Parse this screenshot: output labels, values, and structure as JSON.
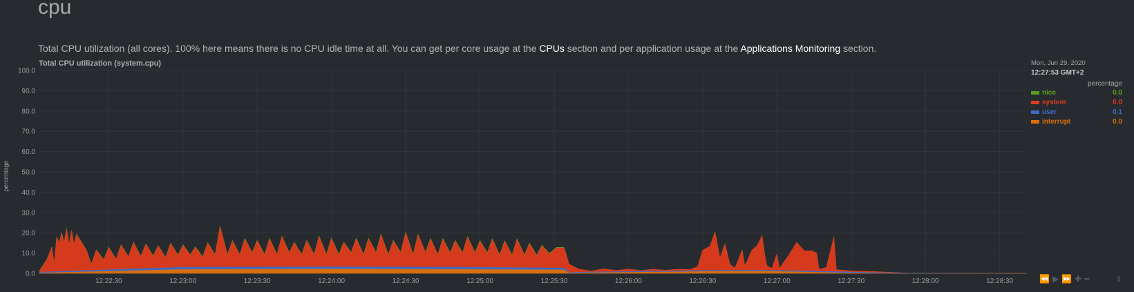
{
  "section": {
    "title": "cpu",
    "description": {
      "part1": "Total CPU utilization (all cores). 100% here means there is no CPU idle time at all. You can get per core usage at the ",
      "link1": "CPUs",
      "part2": " section and per application usage at the ",
      "link2": "Applications Monitoring",
      "part3": " section."
    }
  },
  "legend": {
    "date": "Mon, Jun 29, 2020",
    "time": "12:27:53 GMT+2",
    "units": "percentage",
    "items": [
      {
        "name": "nice",
        "value": "0.0",
        "color": "#5a9e1c"
      },
      {
        "name": "system",
        "value": "0.0",
        "color": "#de3b1c"
      },
      {
        "name": "user",
        "value": "0.1",
        "color": "#3d6cc7"
      },
      {
        "name": "interrupt",
        "value": "0.0",
        "color": "#d86e0c"
      }
    ]
  },
  "toolbar": {
    "icons": [
      "rewind-icon",
      "play-icon",
      "fast-forward-icon",
      "zoom-in-icon",
      "zoom-out-icon"
    ],
    "glyphs": [
      "⏪",
      "▶",
      "⏩",
      "✚",
      "━"
    ],
    "resize_glyph": "⬍"
  },
  "chart_data": {
    "type": "area",
    "stacked": true,
    "title": "Total CPU utilization (system.cpu)",
    "ylabel": "percentage",
    "ylim": [
      0,
      100
    ],
    "yticks": [
      "0.0",
      "10.0",
      "20.0",
      "30.0",
      "40.0",
      "50.0",
      "60.0",
      "70.0",
      "80.0",
      "90.0",
      "100.0"
    ],
    "xlim": [
      "12:22:02",
      "12:28:41"
    ],
    "xticks": [
      "12:22:30",
      "12:23:00",
      "12:23:30",
      "12:24:00",
      "12:24:30",
      "12:25:00",
      "12:25:30",
      "12:26:00",
      "12:26:30",
      "12:27:00",
      "12:27:30",
      "12:28:00",
      "12:28:30"
    ],
    "grid": true,
    "legend_position": "right",
    "series": [
      {
        "name": "interrupt",
        "color": "#d86e0c",
        "points": [
          [
            "12:22:02",
            0.3
          ],
          [
            "12:23:00",
            2.0
          ],
          [
            "12:24:00",
            2.2
          ],
          [
            "12:25:00",
            2.0
          ],
          [
            "12:25:34",
            1.8
          ],
          [
            "12:25:36",
            0.3
          ],
          [
            "12:26:30",
            1.0
          ],
          [
            "12:26:55",
            1.2
          ],
          [
            "12:27:25",
            0.4
          ],
          [
            "12:27:53",
            0.0
          ],
          [
            "12:28:41",
            0.0
          ]
        ]
      },
      {
        "name": "user",
        "color": "#3d6cc7",
        "points": [
          [
            "12:22:02",
            0.3
          ],
          [
            "12:23:00",
            1.0
          ],
          [
            "12:24:00",
            1.0
          ],
          [
            "12:25:00",
            1.0
          ],
          [
            "12:25:34",
            0.8
          ],
          [
            "12:25:36",
            0.2
          ],
          [
            "12:26:30",
            0.4
          ],
          [
            "12:27:25",
            0.4
          ],
          [
            "12:27:53",
            0.1
          ],
          [
            "12:28:41",
            0.0
          ]
        ]
      },
      {
        "name": "system",
        "color": "#de3b1c",
        "points": [
          [
            "12:22:02",
            0.5
          ],
          [
            "12:22:05",
            6
          ],
          [
            "12:22:07",
            12
          ],
          [
            "12:22:08",
            4
          ],
          [
            "12:22:09",
            17
          ],
          [
            "12:22:10",
            14
          ],
          [
            "12:22:11",
            19
          ],
          [
            "12:22:12",
            14
          ],
          [
            "12:22:13",
            21
          ],
          [
            "12:22:14",
            13
          ],
          [
            "12:22:15",
            20
          ],
          [
            "12:22:16",
            13
          ],
          [
            "12:22:17",
            18
          ],
          [
            "12:22:19",
            14
          ],
          [
            "12:22:21",
            10
          ],
          [
            "12:22:23",
            3
          ],
          [
            "12:22:25",
            10
          ],
          [
            "12:22:28",
            5
          ],
          [
            "12:22:30",
            11
          ],
          [
            "12:22:33",
            5
          ],
          [
            "12:22:35",
            12
          ],
          [
            "12:22:38",
            6
          ],
          [
            "12:22:40",
            13
          ],
          [
            "12:22:43",
            6
          ],
          [
            "12:22:45",
            12
          ],
          [
            "12:22:48",
            6
          ],
          [
            "12:22:50",
            11
          ],
          [
            "12:22:53",
            5
          ],
          [
            "12:22:55",
            12
          ],
          [
            "12:22:58",
            6
          ],
          [
            "12:23:00",
            11
          ],
          [
            "12:23:03",
            6
          ],
          [
            "12:23:05",
            10
          ],
          [
            "12:23:08",
            5
          ],
          [
            "12:23:10",
            12
          ],
          [
            "12:23:13",
            6
          ],
          [
            "12:23:15",
            20
          ],
          [
            "12:23:18",
            6
          ],
          [
            "12:23:20",
            13
          ],
          [
            "12:23:23",
            6
          ],
          [
            "12:23:25",
            14
          ],
          [
            "12:23:28",
            7
          ],
          [
            "12:23:30",
            13
          ],
          [
            "12:23:33",
            6
          ],
          [
            "12:23:35",
            14
          ],
          [
            "12:23:38",
            6
          ],
          [
            "12:23:40",
            15
          ],
          [
            "12:23:43",
            7
          ],
          [
            "12:23:45",
            12
          ],
          [
            "12:23:48",
            6
          ],
          [
            "12:23:50",
            13
          ],
          [
            "12:23:53",
            6
          ],
          [
            "12:23:55",
            15
          ],
          [
            "12:23:58",
            6
          ],
          [
            "12:24:00",
            14
          ],
          [
            "12:24:03",
            6
          ],
          [
            "12:24:05",
            12
          ],
          [
            "12:24:08",
            7
          ],
          [
            "12:24:10",
            14
          ],
          [
            "12:24:13",
            6
          ],
          [
            "12:24:15",
            14
          ],
          [
            "12:24:18",
            7
          ],
          [
            "12:24:20",
            16
          ],
          [
            "12:24:23",
            6
          ],
          [
            "12:24:25",
            13
          ],
          [
            "12:24:28",
            7
          ],
          [
            "12:24:30",
            17
          ],
          [
            "12:24:33",
            6
          ],
          [
            "12:24:35",
            16
          ],
          [
            "12:24:38",
            7
          ],
          [
            "12:24:40",
            14
          ],
          [
            "12:24:43",
            6
          ],
          [
            "12:24:45",
            14
          ],
          [
            "12:24:48",
            7
          ],
          [
            "12:24:50",
            13
          ],
          [
            "12:24:53",
            7
          ],
          [
            "12:24:55",
            15
          ],
          [
            "12:24:58",
            7
          ],
          [
            "12:25:00",
            13
          ],
          [
            "12:25:03",
            7
          ],
          [
            "12:25:05",
            14
          ],
          [
            "12:25:08",
            6
          ],
          [
            "12:25:10",
            13
          ],
          [
            "12:25:13",
            6
          ],
          [
            "12:25:15",
            14
          ],
          [
            "12:25:18",
            6
          ],
          [
            "12:25:20",
            12
          ],
          [
            "12:25:23",
            6
          ],
          [
            "12:25:25",
            11
          ],
          [
            "12:25:28",
            7
          ],
          [
            "12:25:31",
            10
          ],
          [
            "12:25:34",
            10
          ],
          [
            "12:25:36",
            4
          ],
          [
            "12:25:40",
            1.5
          ],
          [
            "12:25:45",
            0.5
          ],
          [
            "12:25:50",
            1.5
          ],
          [
            "12:25:55",
            0.6
          ],
          [
            "12:26:00",
            1.2
          ],
          [
            "12:26:05",
            0.4
          ],
          [
            "12:26:10",
            1.0
          ],
          [
            "12:26:15",
            0.4
          ],
          [
            "12:26:20",
            0.8
          ],
          [
            "12:26:25",
            0.6
          ],
          [
            "12:26:28",
            2
          ],
          [
            "12:26:30",
            10
          ],
          [
            "12:26:33",
            12
          ],
          [
            "12:26:35",
            19
          ],
          [
            "12:26:37",
            6
          ],
          [
            "12:26:39",
            13
          ],
          [
            "12:26:41",
            3
          ],
          [
            "12:26:43",
            1
          ],
          [
            "12:26:46",
            10
          ],
          [
            "12:26:47",
            2
          ],
          [
            "12:26:50",
            10
          ],
          [
            "12:26:52",
            12
          ],
          [
            "12:26:54",
            17
          ],
          [
            "12:26:55",
            8
          ],
          [
            "12:26:56",
            2
          ],
          [
            "12:26:58",
            1
          ],
          [
            "12:27:00",
            8
          ],
          [
            "12:27:01",
            1
          ],
          [
            "12:27:05",
            8
          ],
          [
            "12:27:08",
            14
          ],
          [
            "12:27:11",
            10
          ],
          [
            "12:27:14",
            10
          ],
          [
            "12:27:16",
            9
          ],
          [
            "12:27:17",
            1
          ],
          [
            "12:27:20",
            2
          ],
          [
            "12:27:23",
            17
          ],
          [
            "12:27:24",
            1
          ],
          [
            "12:27:30",
            0.5
          ],
          [
            "12:27:40",
            0.4
          ],
          [
            "12:27:53",
            0.0
          ],
          [
            "12:28:41",
            0.0
          ]
        ]
      },
      {
        "name": "nice",
        "color": "#5a9e1c",
        "points": [
          [
            "12:22:02",
            0.1
          ],
          [
            "12:25:34",
            0.2
          ],
          [
            "12:25:36",
            0.0
          ],
          [
            "12:28:41",
            0.0
          ]
        ]
      }
    ]
  }
}
